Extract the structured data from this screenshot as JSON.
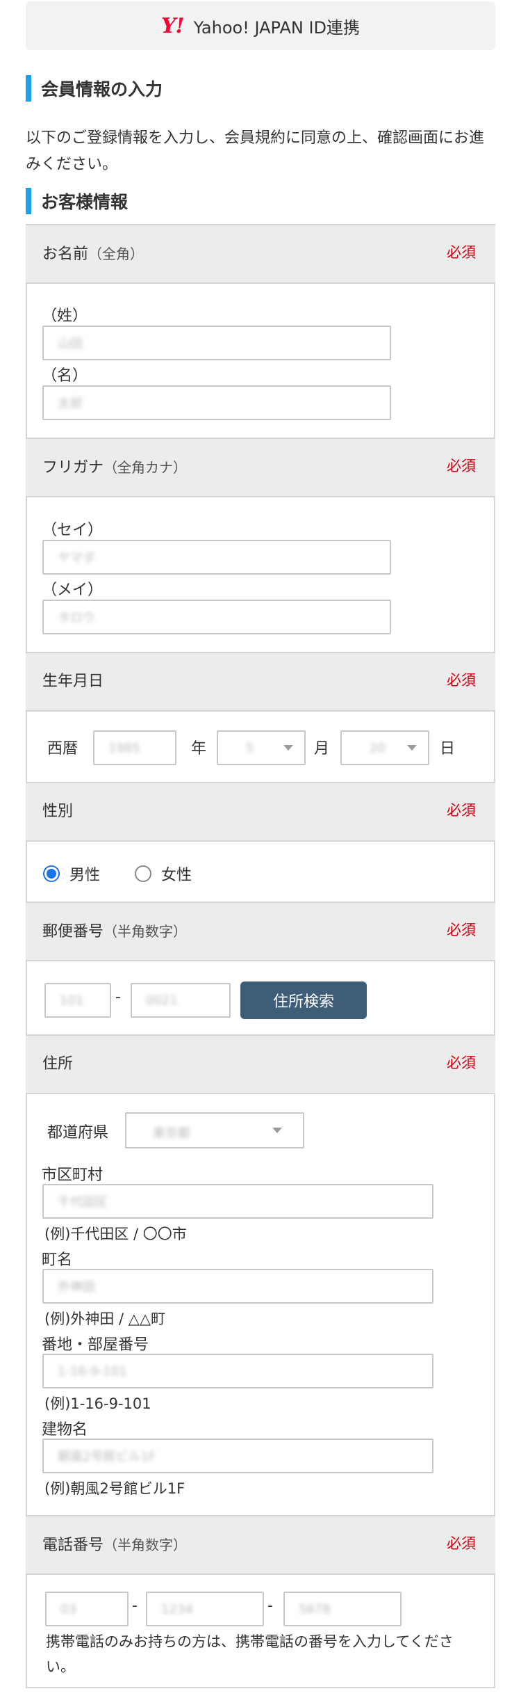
{
  "header": {
    "logo_text": "Y!",
    "title": "Yahoo! JAPAN ID連携"
  },
  "section1": {
    "title": "会員情報の入力",
    "intro": "以下のご登録情報を入力し、会員規約に同意の上、確認画面にお進みください。"
  },
  "section2": {
    "title": "お客様情報"
  },
  "required_label": "必須",
  "name": {
    "label": "お名前",
    "sub": "（全角）",
    "sei_label": "（姓）",
    "sei_value": "山田",
    "mei_label": "（名）",
    "mei_value": "太郎"
  },
  "kana": {
    "label": "フリガナ",
    "sub": "（全角カナ）",
    "sei_label": "（セイ）",
    "sei_value": "ヤマダ",
    "mei_label": "（メイ）",
    "mei_value": "タロウ"
  },
  "birth": {
    "label": "生年月日",
    "era_label": "西暦",
    "year_value": "1985",
    "year_unit": "年",
    "month_value": "5",
    "month_unit": "月",
    "day_value": "20",
    "day_unit": "日"
  },
  "gender": {
    "label": "性別",
    "options": [
      "男性",
      "女性"
    ],
    "selected": "男性"
  },
  "postal": {
    "label": "郵便番号",
    "sub": "（半角数字）",
    "part1": "101",
    "separator": "-",
    "part2": "0021",
    "search_button": "住所検索"
  },
  "address": {
    "label": "住所",
    "pref_label": "都道府県",
    "pref_value": "東京都",
    "city_label": "市区町村",
    "city_value": "千代田区",
    "city_example": "(例)千代田区 / 〇〇市",
    "town_label": "町名",
    "town_value": "外神田",
    "town_example": "(例)外神田 / △△町",
    "block_label": "番地・部屋番号",
    "block_value": "1-16-9-101",
    "block_example": "(例)1-16-9-101",
    "building_label": "建物名",
    "building_value": "朝風2号館ビル1F",
    "building_example": "(例)朝風2号館ビル1F"
  },
  "phone": {
    "label": "電話番号",
    "sub": "（半角数字）",
    "part1": "03",
    "part2": "1234",
    "part3": "5678",
    "separator": "-",
    "note": "携帯電話のみお持ちの方は、携帯電話の番号を入力してください。"
  },
  "colors": {
    "accent_bar": "#1ea0e6",
    "required": "#d7000f",
    "button": "#3d5d78",
    "radio": "#1a73e8",
    "yahoo_red": "#ff0033"
  },
  "icons": {
    "dropdown": "chevron-down-icon",
    "radio": "radio-icon"
  }
}
